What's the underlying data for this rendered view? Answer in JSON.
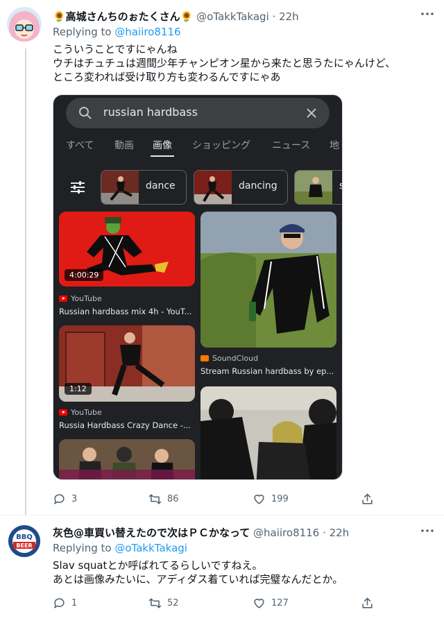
{
  "tweet1": {
    "name": "🌻高城さんちのぉたくさん🌻",
    "handle": "@oTakkTakagi",
    "dot": "·",
    "time": "22h",
    "replying_label": "Replying to",
    "replying_handle": "@haiiro8116",
    "text": "こういうことですにゃんね\nウチはチュチュは週間少年チャンピオン星から来たと思うたにゃんけど、\nところ変われば受け取り方も変わるんですにゃあ",
    "replies": "3",
    "retweets": "86",
    "likes": "199"
  },
  "media": {
    "query": "russian hardbass",
    "tabs": [
      "すべて",
      "動画",
      "画像",
      "ショッピング",
      "ニュース",
      "地"
    ],
    "chips": [
      "dance",
      "dancing",
      "s"
    ],
    "results": [
      {
        "duration": "4:00:29",
        "source": "YouTube",
        "title": "Russian hardbass mix 4h - YouT..."
      },
      {
        "source": "SoundCloud",
        "title": "Stream Russian hardbass by ep..."
      },
      {
        "duration": "1:12",
        "source": "YouTube",
        "title": "Russia Hardbass Crazy Dance -..."
      }
    ],
    "colors": {
      "background": "#1f2124",
      "search": "#3c4043",
      "text": "#e8eaed"
    }
  },
  "tweet2": {
    "name": "灰色@車買い替えたので次はＰＣかなって",
    "handle": "@haiiro8116",
    "dot": "·",
    "time": "22h",
    "replying_label": "Replying to",
    "replying_handle": "@oTakkTakagi",
    "text": "Slav squatとか呼ばれてるらしいですねえ。\nあとは画像みたいに、アディダス着ていれば完璧なんだとか。",
    "replies": "1",
    "retweets": "52",
    "likes": "127"
  },
  "icons": [
    "reply-icon",
    "retweet-icon",
    "like-icon",
    "share-icon",
    "more-icon",
    "search-icon",
    "close-icon",
    "tune-icon"
  ],
  "colors": {
    "link": "#1d9bf0",
    "secondary": "#536471",
    "thread": "#cfd9de"
  }
}
